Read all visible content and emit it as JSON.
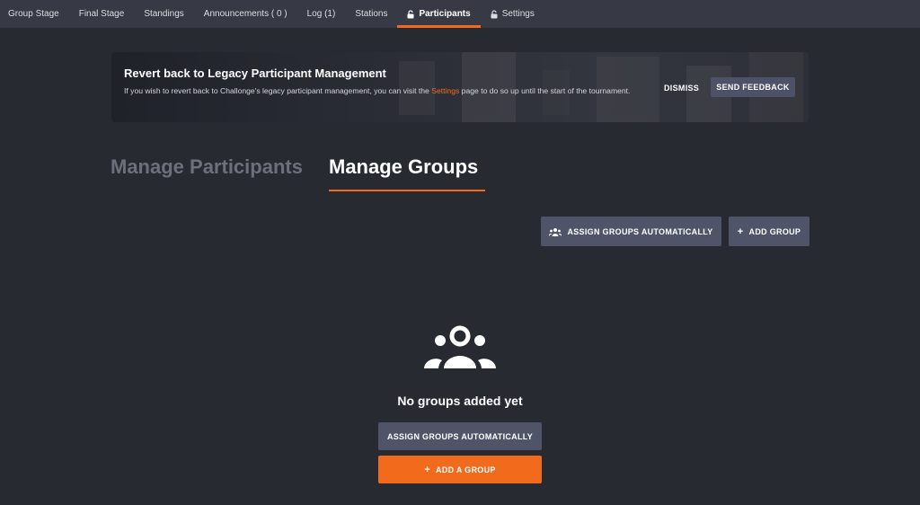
{
  "nav": {
    "tabs": [
      {
        "label": "Group Stage"
      },
      {
        "label": "Final Stage"
      },
      {
        "label": "Standings"
      },
      {
        "label": "Announcements ( 0 )"
      },
      {
        "label": "Log (1)"
      },
      {
        "label": "Stations"
      },
      {
        "label": "Participants",
        "icon": "lock-icon",
        "active": true
      },
      {
        "label": "Settings",
        "icon": "lock-icon"
      }
    ]
  },
  "banner": {
    "title": "Revert back to Legacy Participant Management",
    "desc_before": "If you wish to revert back to Challonge's legacy participant management, you can visit the ",
    "desc_link": "Settings",
    "desc_after": " page to do so up until the start of the tournament.",
    "dismiss_label": "DISMISS",
    "feedback_label": "SEND FEEDBACK"
  },
  "headings": {
    "manage_participants": "Manage Participants",
    "manage_groups": "Manage Groups"
  },
  "actions": {
    "assign_auto_label": "ASSIGN GROUPS AUTOMATICALLY",
    "add_group_label": "ADD GROUP"
  },
  "empty_state": {
    "icon": "users-group-icon",
    "message": "No groups added yet",
    "assign_auto_label": "ASSIGN GROUPS AUTOMATICALLY",
    "add_group_label": "ADD A GROUP"
  },
  "colors": {
    "accent": "#f26b1d",
    "background": "#282a32",
    "nav_background": "#373a44",
    "button": "#4f5469"
  }
}
